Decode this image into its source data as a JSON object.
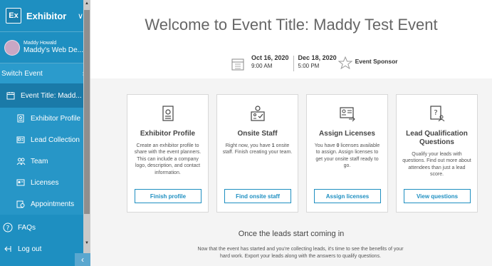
{
  "sidebar": {
    "logo_text": "Ex",
    "app_title": "Exhibitor",
    "user_name": "Maddy Howald",
    "user_sub": "Maddy's Web De...",
    "switch_event": "Switch Event",
    "event_item": "Event Title: Madd...",
    "items": [
      {
        "label": "Exhibitor Profile"
      },
      {
        "label": "Lead Collection"
      },
      {
        "label": "Team"
      },
      {
        "label": "Licenses"
      },
      {
        "label": "Appointments"
      }
    ],
    "faqs": "FAQs",
    "logout": "Log out"
  },
  "main": {
    "welcome": "Welcome to Event Title: Maddy Test Event",
    "start_date": "Oct 16, 2020",
    "start_time": "9:00 AM",
    "end_date": "Dec 18, 2020",
    "end_time": "5:00 PM",
    "sponsor": "Event Sponsor",
    "cards": [
      {
        "title": "Exhibitor Profile",
        "text": "Create an exhibitor profile to share with the event planners. This can include a company logo, description, and contact information.",
        "button": "Finish profile"
      },
      {
        "title": "Onsite Staff",
        "text_a": "Right now, you have ",
        "count": "1",
        "text_b": " onsite staff. Finish creating your team.",
        "button": "Find onsite staff"
      },
      {
        "title": "Assign Licenses",
        "text_a": "You have ",
        "count": "0",
        "text_b": " licenses available to assign. Assign licenses to get your onsite staff ready to go.",
        "button": "Assign licenses"
      },
      {
        "title": "Lead Qualification Questions",
        "text": "Qualify your leads with questions. Find out more about attendees than just a lead score.",
        "button": "View questions"
      }
    ],
    "leads_title": "Once the leads start coming in",
    "leads_text": "Now that the event has started and you're collecting leads, it's time to see the benefits of your hard work. Export your leads along with the answers to qualify questions."
  }
}
